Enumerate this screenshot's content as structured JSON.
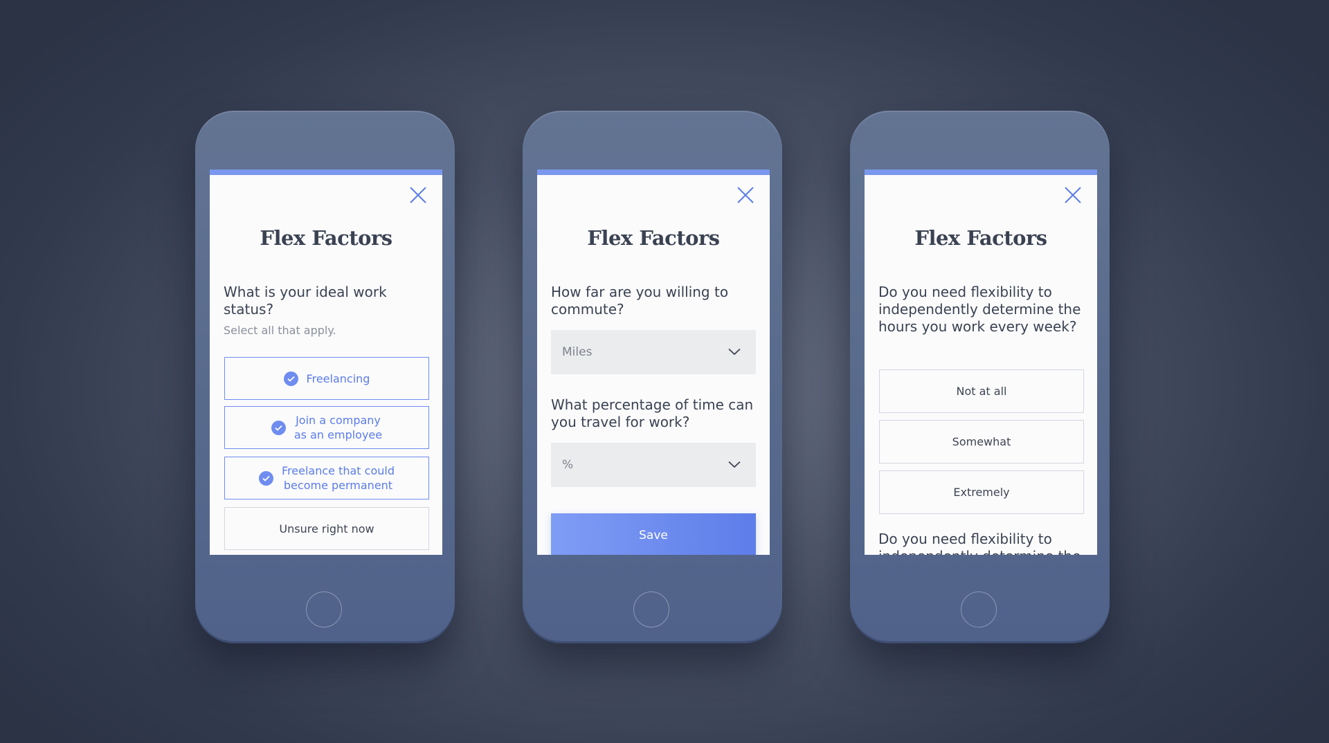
{
  "colors": {
    "accent": "#6e8cf0",
    "accent_text": "#5b7ce8",
    "save_gradient_start": "#7f9df5",
    "save_gradient_end": "#5e7de9",
    "text": "#3a4252",
    "phone_body": "#586a8c"
  },
  "icons": {
    "close": "close-icon",
    "check": "check-icon",
    "dropdown": "chevron-down-icon"
  },
  "phones": [
    {
      "title": "Flex Factors",
      "question": "What is your ideal work status?",
      "hint": "Select all that apply.",
      "options": [
        {
          "label": "Freelancing",
          "selected": true
        },
        {
          "label": "Join a company\nas an employee",
          "selected": true
        },
        {
          "label": "Freelance that could\nbecome permanent",
          "selected": true
        },
        {
          "label": "Unsure right now",
          "selected": false
        }
      ]
    },
    {
      "title": "Flex Factors",
      "question_commute": "How far are you willing to commute?",
      "commute_select": "Miles",
      "question_travel": "What percentage of time can you travel for work?",
      "travel_select": "%",
      "save_label": "Save"
    },
    {
      "title": "Flex Factors",
      "question_hours": "Do you need flexibility to independently determine the hours you work every week?",
      "options": [
        "Not at all",
        "Somewhat",
        "Extremely"
      ],
      "question_days": "Do you need flexibility to independently determine the days you work every"
    }
  ]
}
